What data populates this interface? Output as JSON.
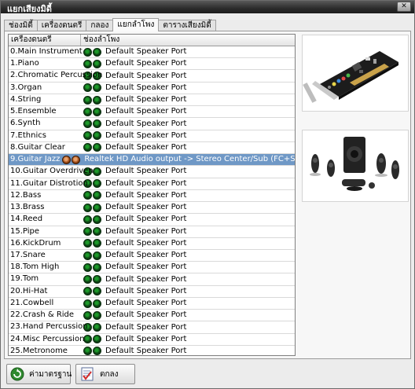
{
  "window": {
    "title": "แยกเสียงมิดี้",
    "close_icon": "close-icon"
  },
  "tabs": [
    {
      "label": "ช่องมิดี้"
    },
    {
      "label": "เครื่องดนตรี"
    },
    {
      "label": "กลอง"
    },
    {
      "label": "แยกลำโพง",
      "active": true
    },
    {
      "label": "ตารางเสียงมิดี้"
    }
  ],
  "grid": {
    "headers": {
      "instrument": "เครื่องดนตรี",
      "port": "ช่องลำโพง"
    },
    "rows": [
      {
        "instrument": "0.Main Instrument",
        "port": "Default Speaker Port"
      },
      {
        "instrument": "1.Piano",
        "port": "Default Speaker Port"
      },
      {
        "instrument": "2.Chromatic Percussion",
        "port": "Default Speaker Port"
      },
      {
        "instrument": "3.Organ",
        "port": "Default Speaker Port"
      },
      {
        "instrument": "4.String",
        "port": "Default Speaker Port"
      },
      {
        "instrument": "5.Ensemble",
        "port": "Default Speaker Port"
      },
      {
        "instrument": "6.Synth",
        "port": "Default Speaker Port"
      },
      {
        "instrument": "7.Ethnics",
        "port": "Default Speaker Port"
      },
      {
        "instrument": "8.Guitar Clear",
        "port": "Default Speaker Port"
      },
      {
        "instrument": "9.Guitar Jazz",
        "port": "Realtek HD Audio output -> Stereo Center/Sub (FC+SW)",
        "selected": true
      },
      {
        "instrument": "10.Guitar Overdriven",
        "port": "Default Speaker Port"
      },
      {
        "instrument": "11.Guitar Distrotion",
        "port": "Default Speaker Port"
      },
      {
        "instrument": "12.Bass",
        "port": "Default Speaker Port"
      },
      {
        "instrument": "13.Brass",
        "port": "Default Speaker Port"
      },
      {
        "instrument": "14.Reed",
        "port": "Default Speaker Port"
      },
      {
        "instrument": "15.Pipe",
        "port": "Default Speaker Port"
      },
      {
        "instrument": "16.KickDrum",
        "port": "Default Speaker Port"
      },
      {
        "instrument": "17.Snare",
        "port": "Default Speaker Port"
      },
      {
        "instrument": "18.Tom High",
        "port": "Default Speaker Port"
      },
      {
        "instrument": "19.Tom",
        "port": "Default Speaker Port"
      },
      {
        "instrument": "20.Hi-Hat",
        "port": "Default Speaker Port"
      },
      {
        "instrument": "21.Cowbell",
        "port": "Default Speaker Port"
      },
      {
        "instrument": "22.Crash & Ride",
        "port": "Default Speaker Port"
      },
      {
        "instrument": "23.Hand Percussion",
        "port": "Default Speaker Port"
      },
      {
        "instrument": "24.Misc Percussion",
        "port": "Default Speaker Port"
      },
      {
        "instrument": "25.Metronome",
        "port": "Default Speaker Port"
      }
    ]
  },
  "images": {
    "top": "sound-card-image",
    "bottom": "speaker-system-image"
  },
  "buttons": {
    "default": {
      "label": "ค่ามาตรฐาน",
      "icon": "reset-icon"
    },
    "ok": {
      "label": "ตกลง",
      "icon": "checklist-icon"
    }
  },
  "colors": {
    "selected_row": "#6f98c6",
    "port_dot": "#1d9a2a",
    "port_dot_selected": "#c46a28"
  }
}
